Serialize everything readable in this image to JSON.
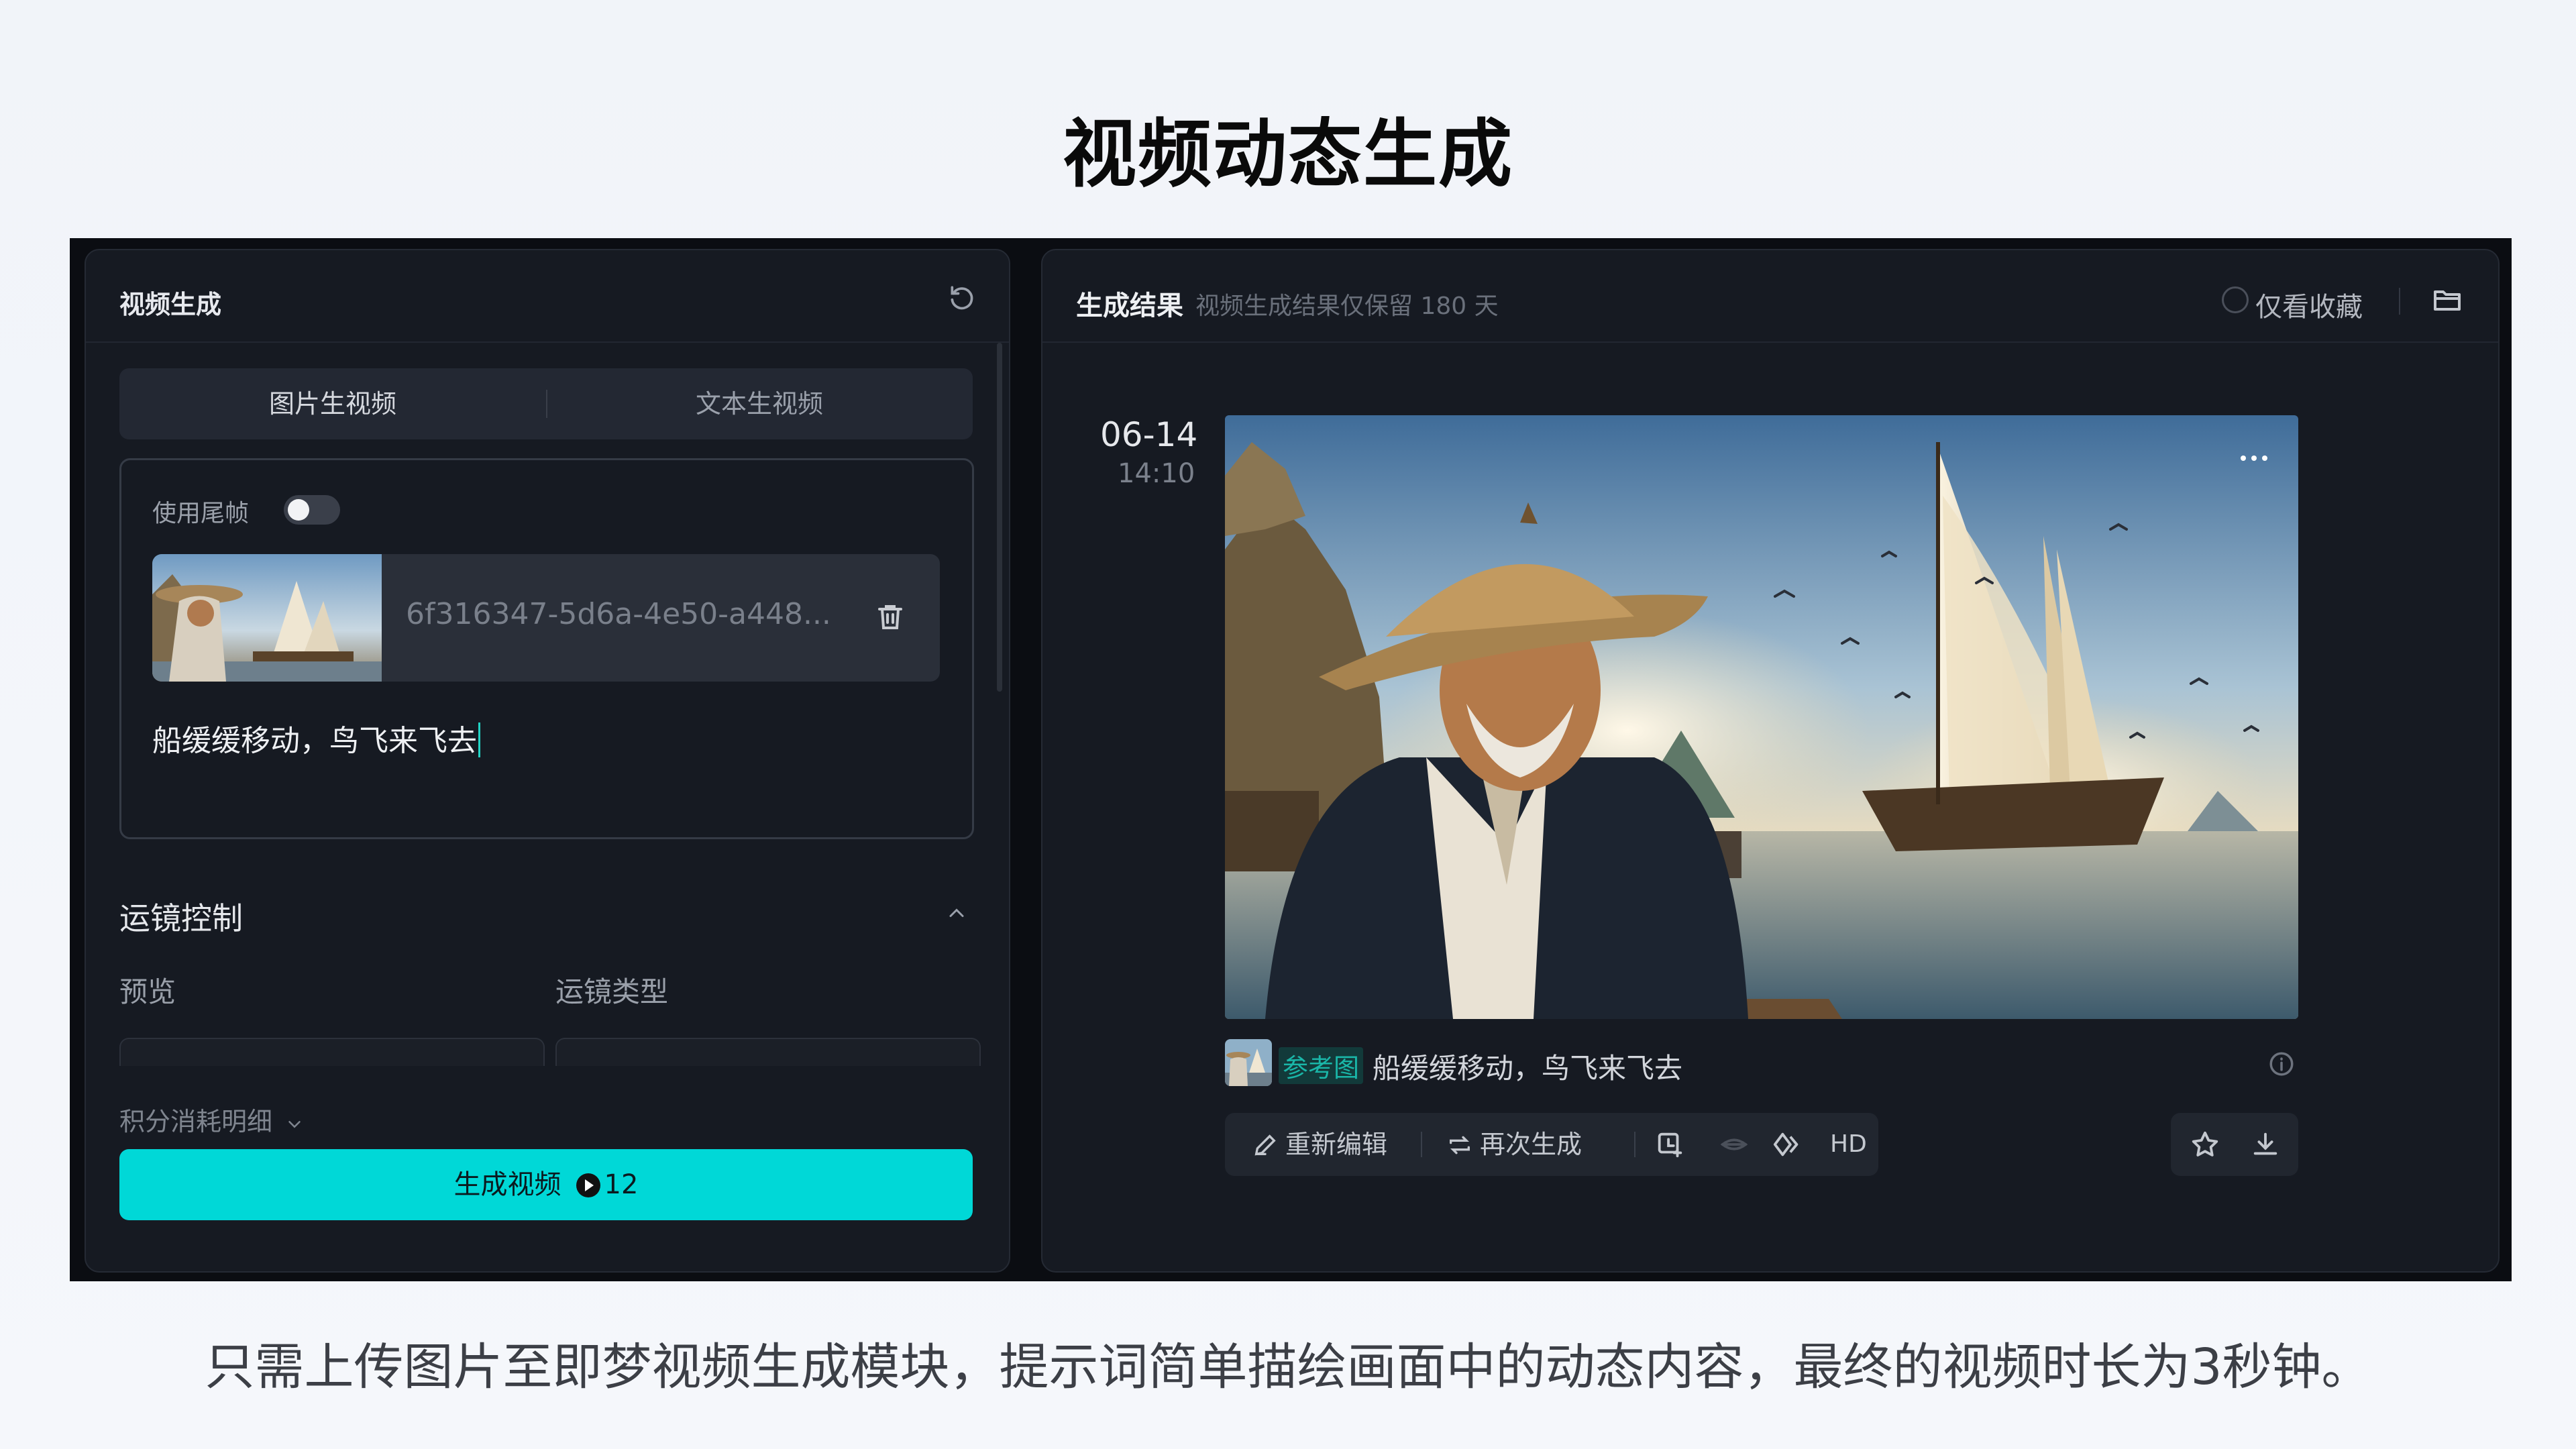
{
  "slide": {
    "title": "视频动态生成",
    "caption": "只需上传图片至即梦视频生成模块，提示词简单描绘画面中的动态内容，最终的视频时长为3秒钟。"
  },
  "left_panel": {
    "title": "视频生成",
    "tabs": [
      {
        "label": "图片生视频",
        "active": true
      },
      {
        "label": "文本生视频",
        "active": false
      }
    ],
    "use_tail_frame": {
      "label": "使用尾帧",
      "enabled": false
    },
    "uploaded_file": {
      "name": "6f316347-5d6a-4e50-a448..."
    },
    "prompt": "船缓缓移动，鸟飞来飞去",
    "camera_section": {
      "title": "运镜控制",
      "preview_label": "预览",
      "type_label": "运镜类型"
    },
    "cost_detail": "积分消耗明细",
    "generate_button": {
      "label": "生成视频",
      "credits": "12"
    }
  },
  "right_panel": {
    "title": "生成结果",
    "subtitle": "视频生成结果仅保留 180 天",
    "favorites_only": "仅看收藏",
    "result": {
      "date": "06-14",
      "time": "14:10",
      "ref_badge": "参考图",
      "prompt": "船缓缓移动，鸟飞来飞去",
      "actions": {
        "re_edit": "重新编辑",
        "regenerate": "再次生成",
        "hd": "HD"
      }
    }
  },
  "colors": {
    "accent": "#00d8d7",
    "app_bg": "#0b0d12",
    "panel_bg": "#161a22"
  }
}
